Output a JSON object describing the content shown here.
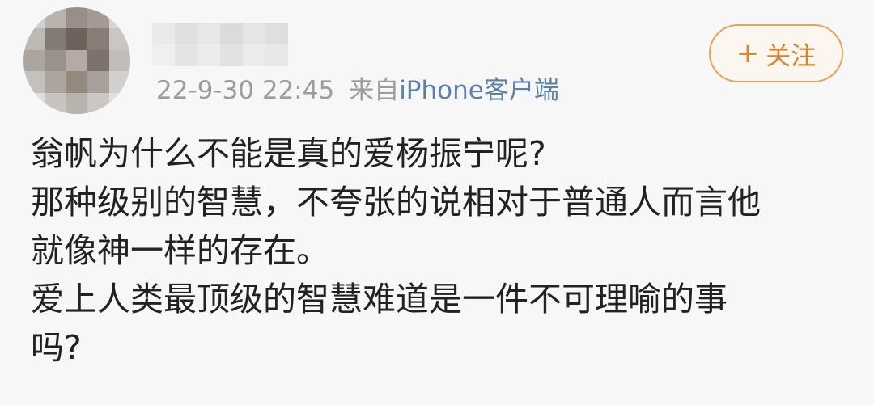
{
  "post": {
    "username": "",
    "timestamp": "22-9-30 22:45",
    "source_prefix": "来自",
    "source_app": "iPhone客户端",
    "follow_button": {
      "icon": "plus-icon",
      "symbol": "+",
      "label": "关注"
    },
    "avatar_icon": "blurred-avatar",
    "content_lines": [
      "翁帆为什么不能是真的爱杨振宁呢?",
      "那种级别的智慧，不夸张的说相对于普通人而言他",
      "就像神一样的存在。",
      "爱上人类最顶级的智慧难道是一件不可理喻的事",
      "吗?"
    ]
  },
  "colors": {
    "background": "#f7f7f7",
    "text": "#222222",
    "meta_text": "#9c9c9c",
    "source_link": "#5d7fa8",
    "follow_accent": "#e7a35a",
    "follow_text": "#d9822b"
  }
}
